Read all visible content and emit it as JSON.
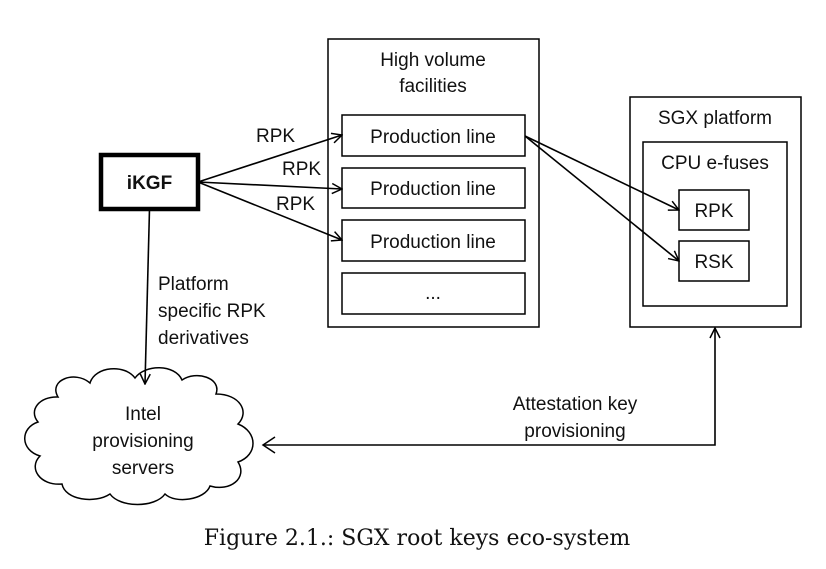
{
  "diagram": {
    "nodes": {
      "ikgf": {
        "label": "iKGF"
      },
      "facilities": {
        "title_line1": "High volume",
        "title_line2": "facilities",
        "lines": [
          {
            "label": "Production line"
          },
          {
            "label": "Production line"
          },
          {
            "label": "Production line"
          },
          {
            "label": "..."
          }
        ]
      },
      "platform": {
        "title": "SGX platform",
        "efuses": {
          "title": "CPU e-fuses",
          "keys": [
            {
              "label": "RPK"
            },
            {
              "label": "RSK"
            }
          ]
        }
      },
      "servers": {
        "line1": "Intel",
        "line2": "provisioning",
        "line3": "servers"
      }
    },
    "edges": {
      "rpk_labels": [
        "RPK",
        "RPK",
        "RPK"
      ],
      "derivatives": {
        "line1": "Platform",
        "line2": "specific RPK",
        "line3": "derivatives"
      },
      "attestation": {
        "line1": "Attestation key",
        "line2": "provisioning"
      }
    }
  },
  "caption": "Figure 2.1.: SGX root keys eco-system"
}
